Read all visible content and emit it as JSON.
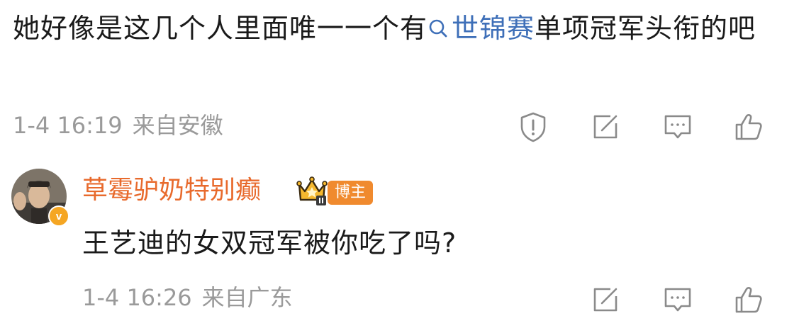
{
  "comment1": {
    "text_before": "她好像是这几个人里面唯一一个有",
    "topic": "世锦赛",
    "text_after": "单项冠军头衔的吧",
    "time": "1-4 16:19",
    "location": "来自安徽",
    "icons": [
      "report-icon",
      "forward-icon",
      "comment-icon",
      "like-icon"
    ]
  },
  "comment2": {
    "username": "草霉驴奶特别癫",
    "badge": "博主",
    "verified_mark": "v",
    "text": "王艺迪的女双冠军被你吃了吗?",
    "time": "1-4 16:26",
    "location": "来自广东",
    "icons": [
      "forward-icon",
      "comment-icon",
      "like-icon"
    ]
  },
  "colors": {
    "text": "#1a1a1a",
    "meta": "#9a9a9a",
    "topic": "#3e6fb8",
    "username": "#e86a2c",
    "badge": "#f08a2e",
    "verified": "#f5a623"
  }
}
